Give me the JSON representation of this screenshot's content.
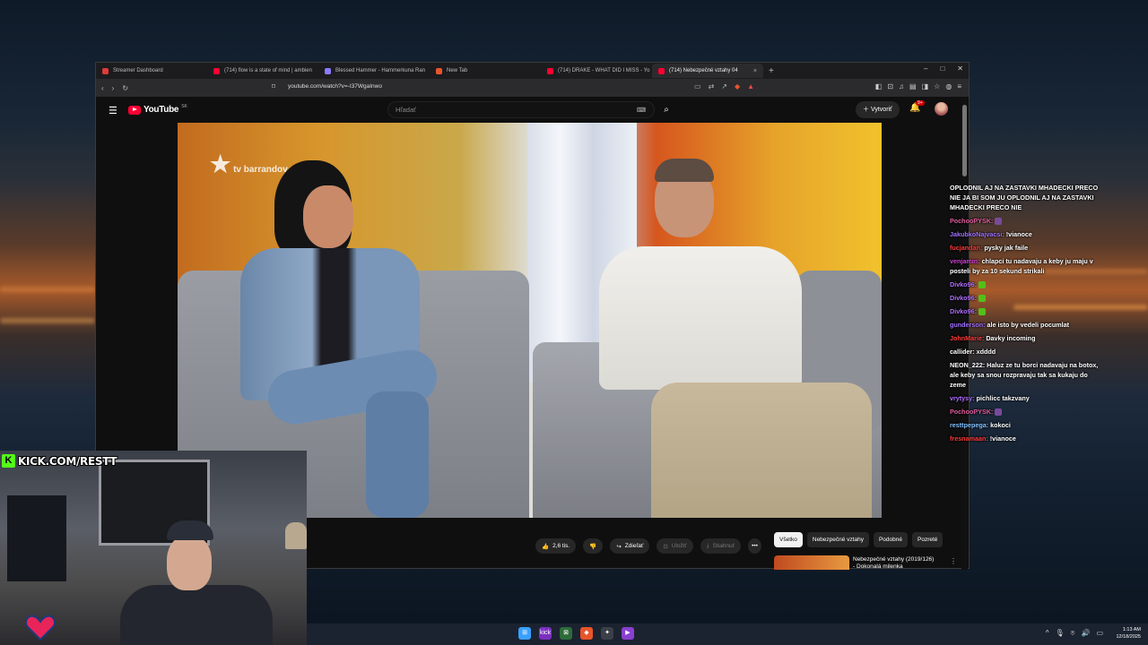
{
  "browser": {
    "tabs": [
      {
        "label": "Streamer Dashboard",
        "color": "#e03a3a"
      },
      {
        "label": "(714) flow is a state of mind | ambien",
        "color": "#ff0033"
      },
      {
        "label": "Blessed Hammer - Hammerkuna Ran",
        "color": "#8a7cff"
      },
      {
        "label": "New Tab",
        "color": "#e8552a"
      },
      {
        "label": "(714) DRAKE - WHAT DID I MISS - Yo",
        "color": "#ff0033"
      },
      {
        "label": "(714) Nebezpečné vztahy 04",
        "color": "#ff0033",
        "active": true
      }
    ],
    "tab_close": "×",
    "new_tab": "+",
    "window_controls": {
      "minimize": "–",
      "maximize": "□",
      "close": "✕"
    },
    "url": "youtube.com/watch?v=-I37WgaInwo",
    "nav": {
      "back": "‹",
      "forward": "›",
      "reload": "↻",
      "bookmark": "⌑"
    },
    "mid_icons": [
      "▭",
      "⇄",
      "↗"
    ],
    "right_icons": [
      "◧",
      "⊡",
      "♫",
      "▤",
      "◨",
      "☆",
      "◍",
      "≡"
    ],
    "ext_badge": "6"
  },
  "youtube": {
    "logo_text": "YouTube",
    "region": "SK",
    "search_placeholder": "Hľadať",
    "create_label": "Vytvoriť",
    "notif_badge": "9+",
    "video_watermark": "tv barrandov",
    "actions": {
      "likes": "2,6 tis.",
      "share": "Zdieľať",
      "save": "Uložiť",
      "download": "Stiahnuť",
      "more": "•••"
    },
    "chips": [
      "Všetko",
      "Nebezpečné vztahy",
      "Podobné",
      "Pozreté"
    ],
    "recommendation": {
      "title_line1": "Nebezpečné vztahy (2019/126)",
      "title_line2": "- Dokonalá milenka"
    }
  },
  "chat": [
    {
      "user": "",
      "text": "OPLODNIL AJ NA ZASTAVKI MHADECKI PRECO NIE JA BI SOM JU OPLODNIL AJ NA ZASTAVKI MHADECKI PRECO NIE",
      "color": "#ffffff"
    },
    {
      "user": "PochooPYSK:",
      "text": "",
      "color": "#e05fa0",
      "emote": "#7a4a9a"
    },
    {
      "user": "JakubkoNajvacsi:",
      "text": "!vianoce",
      "color": "#a070ff"
    },
    {
      "user": "fucjandan:",
      "text": "pysky jak faile",
      "color": "#ff3b3b"
    },
    {
      "user": "venjamin:",
      "text": "chlapci tu nadavaju a keby ju maju v posteli by za 10 sekund strikali",
      "color": "#d040d0"
    },
    {
      "user": "Divko96:",
      "text": "",
      "color": "#b070ff",
      "emote": "#53c018"
    },
    {
      "user": "Divko96:",
      "text": "",
      "color": "#b070ff",
      "emote": "#53c018"
    },
    {
      "user": "Divko96:",
      "text": "",
      "color": "#b070ff",
      "emote": "#53c018"
    },
    {
      "user": "gunderson:",
      "text": "ale isto by vedeli pocumlat",
      "color": "#a070ff"
    },
    {
      "user": "JohnMarie:",
      "text": "Davky incoming",
      "color": "#ff3b3b"
    },
    {
      "user": "callider:",
      "text": "xdddd",
      "color": "#ffffff"
    },
    {
      "user": "NEON_222:",
      "text": "Haluz ze tu borci nadavaju na botox, ale keby sa snou rozpravaju tak sa kukaju do zeme",
      "color": "#ffffff"
    },
    {
      "user": "vrytysy:",
      "text": "pichlicc takzvany",
      "color": "#b070ff"
    },
    {
      "user": "PochooPYSK:",
      "text": "",
      "color": "#e05fa0",
      "emote": "#7a4a9a"
    },
    {
      "user": "resttpepega:",
      "text": "kokoci",
      "color": "#80c0ff"
    },
    {
      "user": "fresnamaan:",
      "text": "!vianoce",
      "color": "#ff3b3b"
    }
  ],
  "stream": {
    "kick_letter": "K",
    "kick_url": "KICK.COM/RESTT"
  },
  "taskbar": {
    "apps": [
      {
        "label": "⊞",
        "color": "#3aa0ff"
      },
      {
        "label": "kick",
        "color": "#7a2fc0"
      },
      {
        "label": "⊠",
        "color": "#2d6b3a"
      },
      {
        "label": "◆",
        "color": "#e8552a"
      },
      {
        "label": "✦",
        "color": "#3a3f48"
      },
      {
        "label": "▶",
        "color": "#8a3fd0"
      }
    ],
    "tray": [
      "^",
      "🎙",
      "⌾",
      "🔊",
      "▭"
    ],
    "time": "1:13 AM",
    "date": "12/18/2025"
  }
}
